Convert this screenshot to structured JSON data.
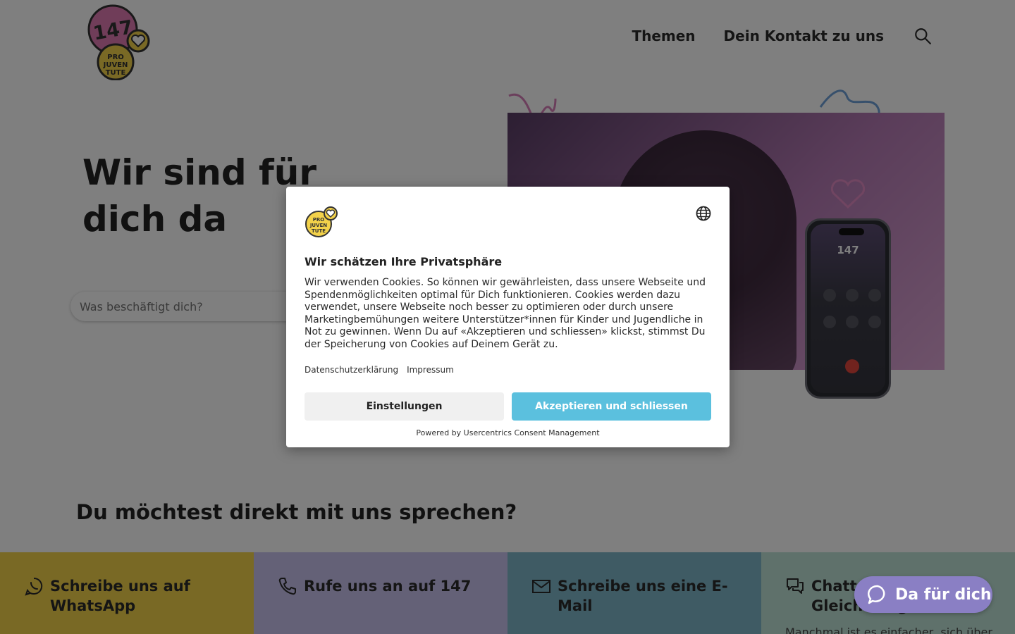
{
  "header": {
    "logo_text": "147",
    "logo_subtext": "PRO JUVENTUTE",
    "nav": [
      {
        "label": "Themen"
      },
      {
        "label": "Dein Kontakt zu uns"
      }
    ],
    "search_icon": "search-icon"
  },
  "hero": {
    "title": "Wir sind für dich da",
    "search_placeholder": "Was beschäftigt dich?",
    "phone_number": "147"
  },
  "direct": {
    "title": "Du möchtest direkt mit uns sprechen?"
  },
  "contact_tiles": [
    {
      "label": "Schreibe uns auf WhatsApp",
      "icon": "whatsapp-icon",
      "color": "#f3d24a"
    },
    {
      "label": "Rufe uns an auf 147",
      "icon": "phone-icon",
      "color": "#c9c3ee"
    },
    {
      "label": "Schreibe uns eine E-Mail",
      "icon": "mail-icon",
      "color": "#7fb7c8"
    },
    {
      "label": "Chatte mit Gleichaltrigen",
      "icon": "chat-bubbles-icon",
      "color": "#bfe3d7",
      "sub": "Manchmal ist es einfacher, sich über"
    }
  ],
  "chat_button": {
    "label": "Da für dich",
    "icon": "chat-icon",
    "color": "#8a7fc4"
  },
  "consent": {
    "title": "Wir schätzen Ihre Privatsphäre",
    "text": "Wir verwenden Cookies. So können wir gewährleisten, dass unsere Webseite und Spendenmöglichkeiten optimal für Dich funktionieren. Cookies werden dazu verwendet, unsere Webseite noch besser zu optimieren oder durch unsere Marketingbemühungen weitere Unterstützer*innen für Kinder und Jugendliche in Not zu gewinnen. Wenn Du auf «Akzeptieren und schliessen» klickst, stimmst Du der Speicherung von Cookies auf Deinem Gerät zu.",
    "links": [
      {
        "label": "Datenschutzerklärung"
      },
      {
        "label": "Impressum"
      }
    ],
    "settings_label": "Einstellungen",
    "accept_label": "Akzeptieren und schliessen",
    "accept_color": "#5bc0de",
    "powered_by": "Powered by Usercentrics Consent Management",
    "language_icon": "globe-icon"
  }
}
